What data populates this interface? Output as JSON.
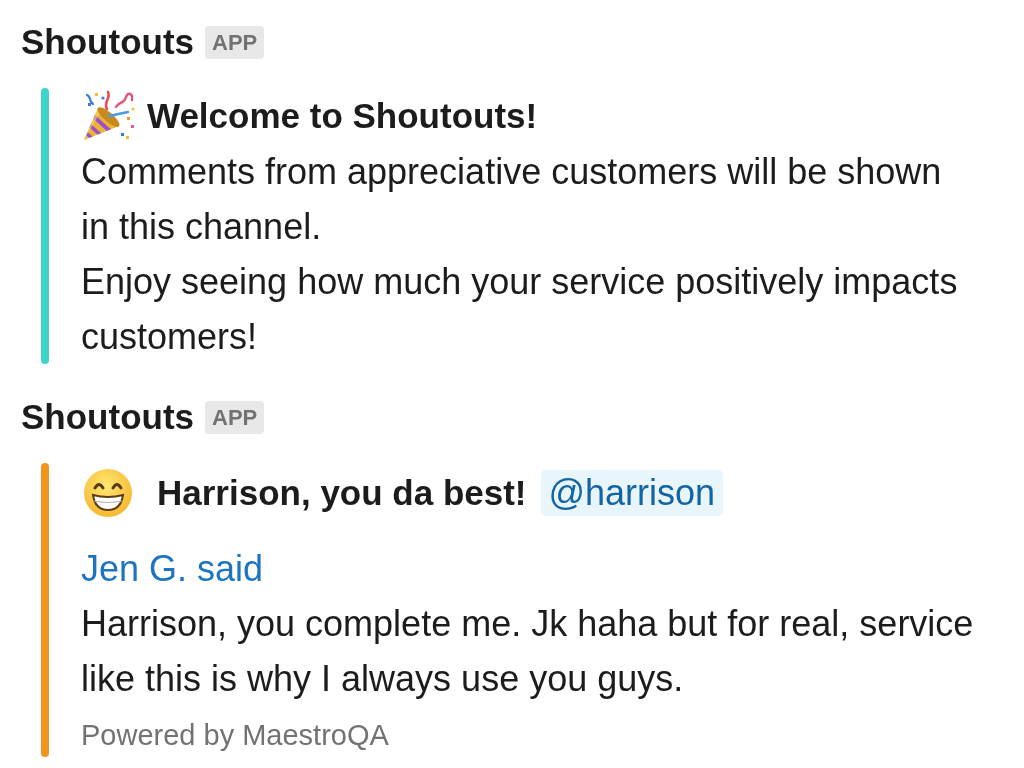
{
  "messages": [
    {
      "sender": "Shoutouts",
      "badge": "APP",
      "attachment": {
        "kind": "welcome",
        "color": "#3dd4ca",
        "title": "Welcome to Shoutouts!",
        "paragraphs": [
          "Comments from appreciative customers will be shown in this channel.",
          "Enjoy seeing how much your service positively impacts customers!"
        ]
      }
    },
    {
      "sender": "Shoutouts",
      "badge": "APP",
      "attachment": {
        "kind": "shoutout",
        "color": "#f0941e",
        "title": "Harrison, you da best!",
        "mention": "@harrison",
        "author": "Jen G. said",
        "paragraphs": [
          "Harrison, you complete me. Jk haha but for real, service like this is why I always use you guys."
        ],
        "footer": "Powered by MaestroQA"
      }
    }
  ]
}
